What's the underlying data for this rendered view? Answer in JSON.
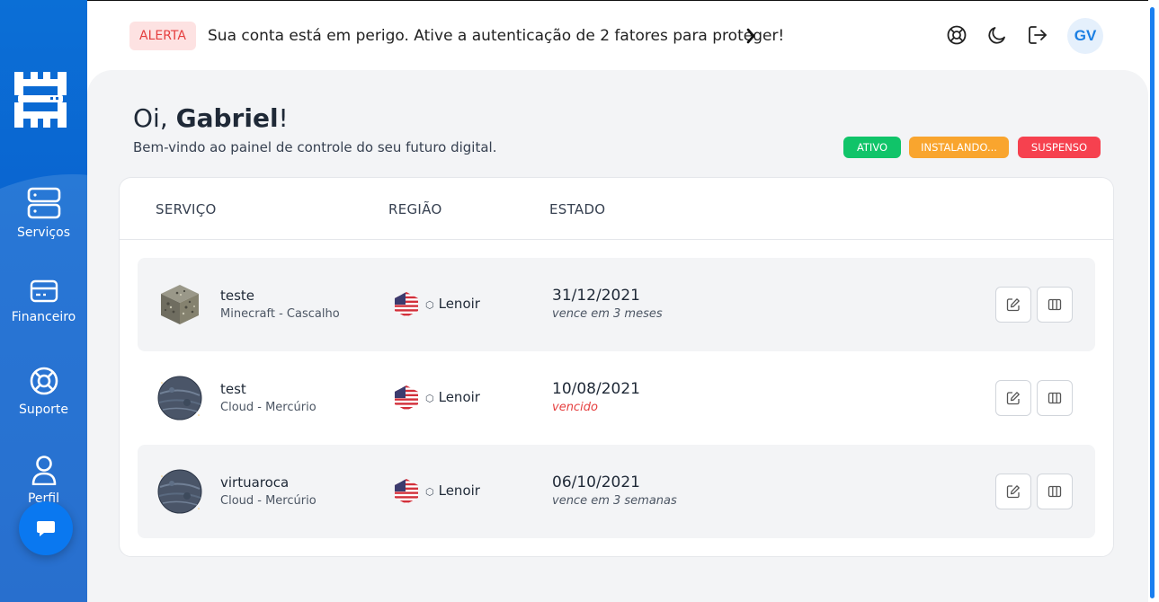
{
  "sidebar": {
    "items": [
      {
        "label": "Serviços",
        "icon": "server-icon"
      },
      {
        "label": "Financeiro",
        "icon": "credit-card-icon"
      },
      {
        "label": "Suporte",
        "icon": "lifebuoy-icon"
      },
      {
        "label": "Perfil",
        "icon": "user-icon"
      }
    ],
    "chat_icon": "chat-icon"
  },
  "topbar": {
    "alert_badge": "ALERTA",
    "alert_text": "Sua conta está em perigo. Ative a autenticação de 2 fatores para proteger!",
    "avatar_initials": "GV",
    "icons": [
      "support-icon",
      "moon-icon",
      "logout-icon"
    ]
  },
  "main": {
    "greeting_prefix": "Oi, ",
    "greeting_name": "Gabriel",
    "greeting_suffix": "!",
    "welcome": "Bem-vindo ao painel de controle do seu futuro digital.",
    "statuses": [
      {
        "label": "ATIVO",
        "color": "#10c469"
      },
      {
        "label": "INSTALANDO...",
        "color": "#f9a52e"
      },
      {
        "label": "SUSPENSO",
        "color": "#f6414f"
      }
    ],
    "table": {
      "headers": [
        "SERVIÇO",
        "REGIÃO",
        "ESTADO"
      ],
      "rows": [
        {
          "name": "teste",
          "sub": "Minecraft - Cascalho",
          "region": "Lenoir",
          "date": "31/12/2021",
          "due": "vence em 3 meses",
          "overdue": false,
          "image": "gravel-block-icon"
        },
        {
          "name": "test",
          "sub": "Cloud - Mercúrio",
          "region": "Lenoir",
          "date": "10/08/2021",
          "due": "vencido",
          "overdue": true,
          "image": "mercury-planet-icon"
        },
        {
          "name": "virtuaroca",
          "sub": "Cloud - Mercúrio",
          "region": "Lenoir",
          "date": "06/10/2021",
          "due": "vence em 3 semanas",
          "overdue": false,
          "image": "mercury-planet-icon"
        }
      ]
    }
  },
  "colors": {
    "primary": "#0a63cf",
    "danger": "#e53e3e",
    "accent": "#1a7ff0"
  }
}
